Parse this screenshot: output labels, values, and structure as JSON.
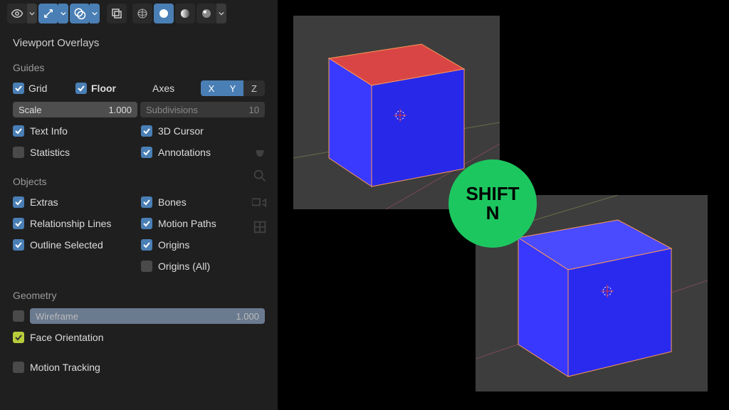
{
  "toolbar": {
    "icons": [
      "eye",
      "arrows",
      "sphere",
      "grid",
      "globe",
      "circle",
      "half",
      "shading"
    ]
  },
  "panel": {
    "title": "Viewport Overlays",
    "sections": {
      "guides": {
        "title": "Guides",
        "grid": "Grid",
        "floor": "Floor",
        "axes_label": "Axes",
        "axes": [
          "X",
          "Y",
          "Z"
        ],
        "scale": {
          "label": "Scale",
          "value": "1.000"
        },
        "subdivisions": {
          "label": "Subdivisions",
          "value": "10"
        },
        "text_info": "Text Info",
        "cursor": "3D Cursor",
        "statistics": "Statistics",
        "annotations": "Annotations"
      },
      "objects": {
        "title": "Objects",
        "extras": "Extras",
        "bones": "Bones",
        "relationship": "Relationship Lines",
        "motion": "Motion Paths",
        "outline": "Outline Selected",
        "origins": "Origins",
        "origins_all": "Origins (All)"
      },
      "geometry": {
        "title": "Geometry",
        "wireframe": {
          "label": "Wireframe",
          "value": "1.000"
        },
        "face_orientation": "Face Orientation"
      },
      "motion_tracking": "Motion Tracking"
    }
  },
  "badge": {
    "line1": "SHIFT",
    "line2": "N"
  },
  "colors": {
    "accent": "#4a7fb5",
    "green": "#1dc760",
    "cube_red": "#e24646",
    "cube_blue": "#3838ff"
  }
}
